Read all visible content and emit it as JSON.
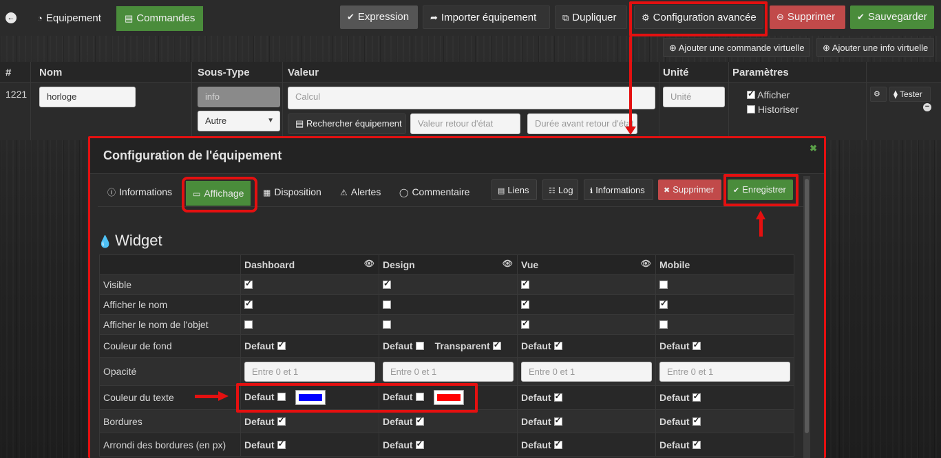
{
  "topbar": {
    "tabs": [
      {
        "label": "Equipement",
        "icon": "dashboard-icon"
      },
      {
        "label": "Commandes",
        "icon": "list-icon"
      }
    ],
    "buttons": {
      "expression": "Expression",
      "importer": "Importer équipement",
      "dupliquer": "Dupliquer",
      "config_avancee": "Configuration avancée",
      "supprimer": "Supprimer",
      "sauvegarder": "Sauvegarder"
    }
  },
  "actions": {
    "add_virtual_cmd": "Ajouter une commande virtuelle",
    "add_virtual_info": "Ajouter une info virtuelle"
  },
  "cmd_table": {
    "headers": [
      "#",
      "Nom",
      "Sous-Type",
      "Valeur",
      "Unité",
      "Paramètres"
    ],
    "row": {
      "id": "1221",
      "nom": "horloge",
      "type": "info",
      "subtype": "Autre",
      "valeur_placeholder": "Calcul",
      "rechercher": "Rechercher équipement",
      "retour_etat_placeholder": "Valeur retour d'état",
      "duree_placeholder": "Durée avant retour d'état",
      "unite_placeholder": "Unité",
      "afficher": "Afficher",
      "historiser": "Historiser",
      "tester": "Tester"
    }
  },
  "modal": {
    "title": "Configuration de l'équipement",
    "tabs": [
      "Informations",
      "Affichage",
      "Disposition",
      "Alertes",
      "Commentaire"
    ],
    "buttons": {
      "liens": "Liens",
      "log": "Log",
      "informations": "Informations",
      "supprimer": "Supprimer",
      "enregistrer": "Enregistrer"
    },
    "widget_title": "Widget",
    "columns": [
      "Dashboard",
      "Design",
      "Vue",
      "Mobile"
    ],
    "rows": [
      {
        "label": "Visible",
        "checks": [
          true,
          true,
          true,
          false
        ]
      },
      {
        "label": "Afficher le nom",
        "checks": [
          true,
          false,
          true,
          true
        ]
      },
      {
        "label": "Afficher le nom de l'objet",
        "checks": [
          false,
          false,
          true,
          false
        ]
      },
      {
        "label": "Couleur de fond",
        "default_label": "Defaut",
        "transparent_label": "Transparent"
      },
      {
        "label": "Opacité",
        "placeholder": "Entre 0 et 1"
      },
      {
        "label": "Couleur du texte"
      },
      {
        "label": "Bordures"
      },
      {
        "label": "Arrondi des bordures (en px)"
      }
    ],
    "text_colors": {
      "dashboard": "#0000ff",
      "design": "#ff0000"
    }
  }
}
